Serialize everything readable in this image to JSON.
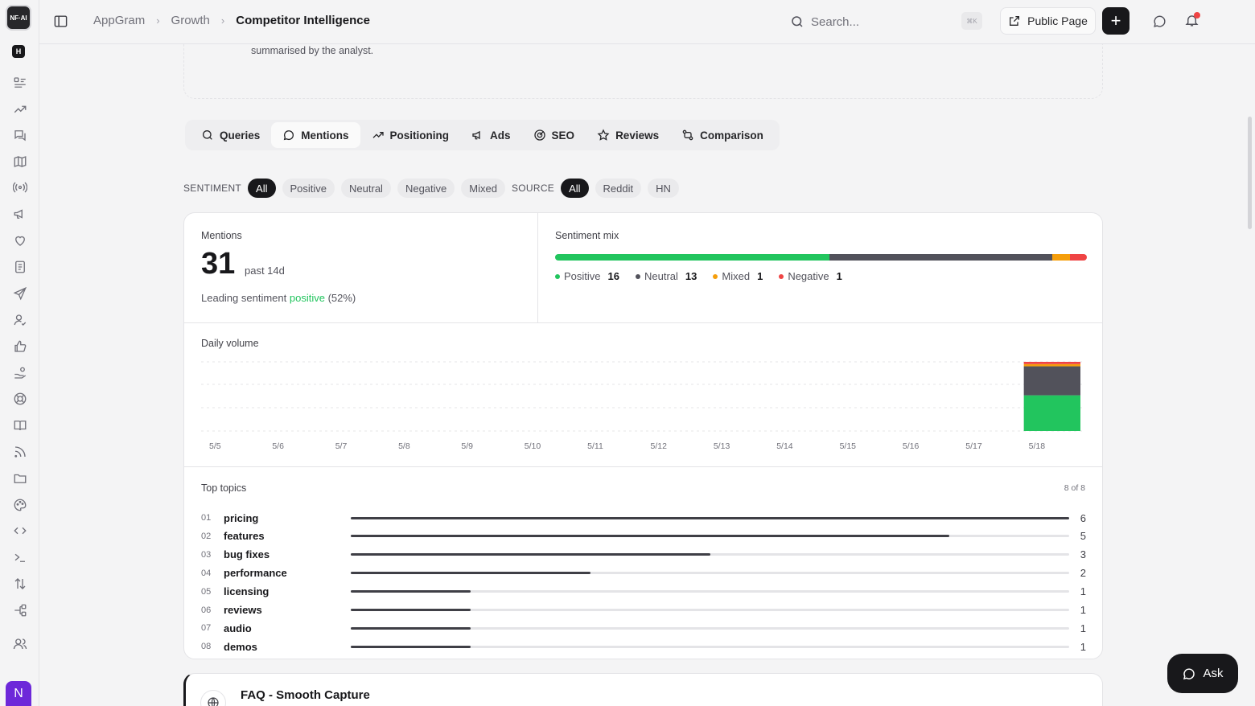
{
  "app": {
    "logo": "NF·AI",
    "workspace_initial": "H",
    "user_initial": "N"
  },
  "breadcrumb": [
    "AppGram",
    "Growth",
    "Competitor Intelligence"
  ],
  "search": {
    "placeholder": "Search...",
    "shortcut": "⌘K"
  },
  "header": {
    "public_page": "Public Page"
  },
  "top_card": {
    "text": "summarised by the analyst."
  },
  "tabs": [
    {
      "label": "Queries",
      "icon": "search-icon"
    },
    {
      "label": "Mentions",
      "icon": "chat-icon"
    },
    {
      "label": "Positioning",
      "icon": "trending-up-icon"
    },
    {
      "label": "Ads",
      "icon": "megaphone-icon"
    },
    {
      "label": "SEO",
      "icon": "target-icon"
    },
    {
      "label": "Reviews",
      "icon": "star-icon"
    },
    {
      "label": "Comparison",
      "icon": "compare-icon"
    }
  ],
  "filters": {
    "sentiment_label": "SENTIMENT",
    "sentiment": [
      "All",
      "Positive",
      "Neutral",
      "Negative",
      "Mixed"
    ],
    "source_label": "SOURCE",
    "source": [
      "All",
      "Reddit",
      "HN"
    ]
  },
  "mentions": {
    "label": "Mentions",
    "count": "31",
    "period": "past 14d",
    "lead_prefix": "Leading sentiment",
    "lead_value": "positive",
    "lead_pct": "(52%)"
  },
  "sentiment_mix": {
    "label": "Sentiment mix",
    "items": [
      {
        "name": "Positive",
        "value": 16,
        "color": "#22c55e"
      },
      {
        "name": "Neutral",
        "value": 13,
        "color": "#52525b"
      },
      {
        "name": "Mixed",
        "value": 1,
        "color": "#f59e0b"
      },
      {
        "name": "Negative",
        "value": 1,
        "color": "#ef4444"
      }
    ]
  },
  "daily_volume": {
    "label": "Daily volume",
    "dates": [
      "5/5",
      "5/6",
      "5/7",
      "5/8",
      "5/9",
      "5/10",
      "5/11",
      "5/12",
      "5/13",
      "5/14",
      "5/15",
      "5/16",
      "5/17",
      "5/18"
    ],
    "stacks": [
      {
        "positive": 0,
        "neutral": 0,
        "mixed": 0,
        "negative": 0
      },
      {
        "positive": 0,
        "neutral": 0,
        "mixed": 0,
        "negative": 0
      },
      {
        "positive": 0,
        "neutral": 0,
        "mixed": 0,
        "negative": 0
      },
      {
        "positive": 0,
        "neutral": 0,
        "mixed": 0,
        "negative": 0
      },
      {
        "positive": 0,
        "neutral": 0,
        "mixed": 0,
        "negative": 0
      },
      {
        "positive": 0,
        "neutral": 0,
        "mixed": 0,
        "negative": 0
      },
      {
        "positive": 0,
        "neutral": 0,
        "mixed": 0,
        "negative": 0
      },
      {
        "positive": 0,
        "neutral": 0,
        "mixed": 0,
        "negative": 0
      },
      {
        "positive": 0,
        "neutral": 0,
        "mixed": 0,
        "negative": 0
      },
      {
        "positive": 0,
        "neutral": 0,
        "mixed": 0,
        "negative": 0
      },
      {
        "positive": 0,
        "neutral": 0,
        "mixed": 0,
        "negative": 0
      },
      {
        "positive": 0,
        "neutral": 0,
        "mixed": 0,
        "negative": 0
      },
      {
        "positive": 0,
        "neutral": 0,
        "mixed": 0,
        "negative": 0
      },
      {
        "positive": 16,
        "neutral": 13,
        "mixed": 1,
        "negative": 1
      }
    ]
  },
  "top_topics": {
    "label": "Top topics",
    "count_text": "8 of 8",
    "max": 6,
    "items": [
      {
        "num": "01",
        "name": "pricing",
        "value": 6
      },
      {
        "num": "02",
        "name": "features",
        "value": 5
      },
      {
        "num": "03",
        "name": "bug fixes",
        "value": 3
      },
      {
        "num": "04",
        "name": "performance",
        "value": 2
      },
      {
        "num": "05",
        "name": "licensing",
        "value": 1
      },
      {
        "num": "06",
        "name": "reviews",
        "value": 1
      },
      {
        "num": "07",
        "name": "audio",
        "value": 1
      },
      {
        "num": "08",
        "name": "demos",
        "value": 1
      }
    ]
  },
  "faq": {
    "title": "FAQ - Smooth Capture"
  },
  "ask": {
    "label": "Ask"
  }
}
